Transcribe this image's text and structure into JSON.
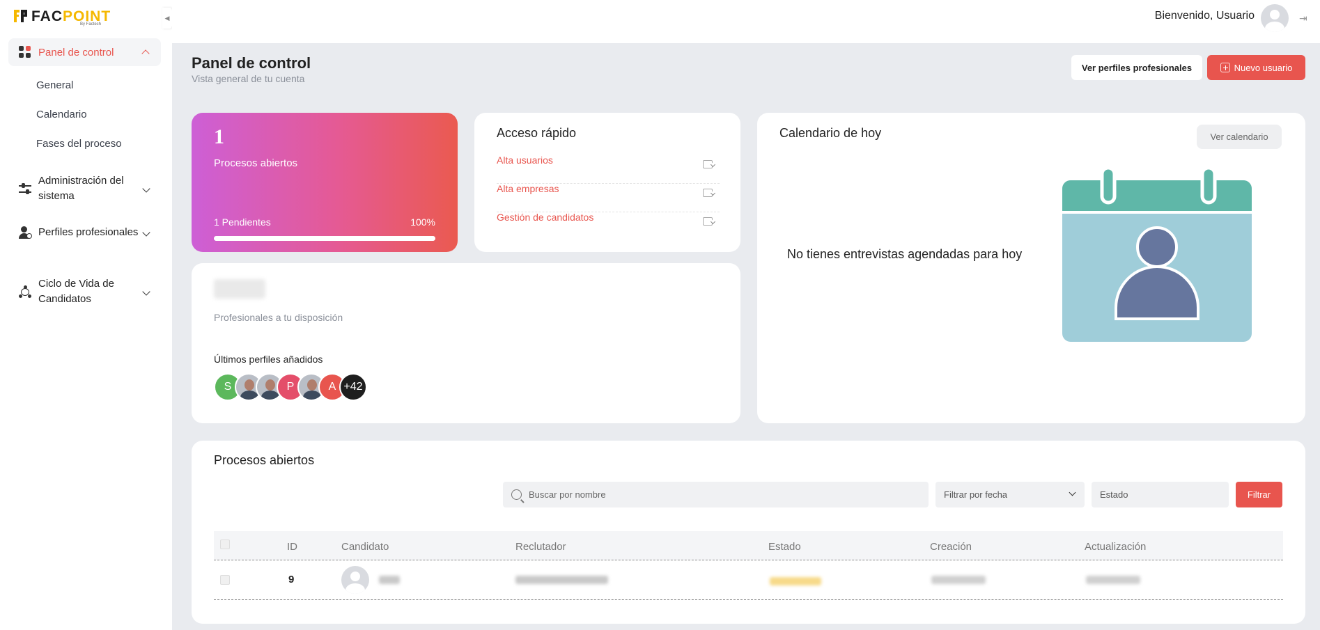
{
  "brand": {
    "logo_main": "FAC",
    "logo_accent": "POINT",
    "logo_sub": "By Factech"
  },
  "sidebar": {
    "main_item": "Panel de control",
    "sub_items": [
      "General",
      "Calendario",
      "Fases del proceso"
    ],
    "groups": [
      "Administración del sistema",
      "Perfiles profesionales",
      "Ciclo de Vida de Candidatos"
    ]
  },
  "header": {
    "welcome": "Bienvenido, Usuario"
  },
  "page": {
    "title": "Panel de control",
    "subtitle": "Vista general de tu cuenta"
  },
  "actions": {
    "profiles_button": "Ver perfiles profesionales",
    "new_user_button": "Nuevo usuario"
  },
  "stats": {
    "count": "1",
    "label": "Procesos abiertos",
    "pending": "1 Pendientes",
    "percent": "100%",
    "progress": 1.0
  },
  "quick_access": {
    "title": "Acceso rápido",
    "links": [
      "Alta usuarios",
      "Alta empresas",
      "Gestión de candidatos"
    ]
  },
  "professionals": {
    "available_label": "Profesionales a tu disposición",
    "latest_label": "Últimos perfiles añadidos",
    "avatars": [
      "S",
      "",
      "",
      "P",
      "",
      "A",
      "+42"
    ]
  },
  "calendar": {
    "title": "Calendario de hoy",
    "button": "Ver calendario",
    "empty_message": "No tienes entrevistas agendadas para hoy"
  },
  "processes": {
    "title": "Procesos abiertos",
    "search_placeholder": "Buscar por nombre",
    "date_filter": "Filtrar por fecha",
    "status_placeholder": "Estado",
    "filter_button": "Filtrar",
    "columns": [
      "ID",
      "Candidato",
      "Reclutador",
      "Estado",
      "Creación",
      "Actualización"
    ],
    "rows": [
      {
        "id": "9"
      }
    ]
  },
  "colors": {
    "accent": "#e8554e",
    "brand_yellow": "#f5b800",
    "calendar_teal": "#5fb7a8",
    "calendar_body": "#9fcdd9",
    "person": "#66769e"
  }
}
